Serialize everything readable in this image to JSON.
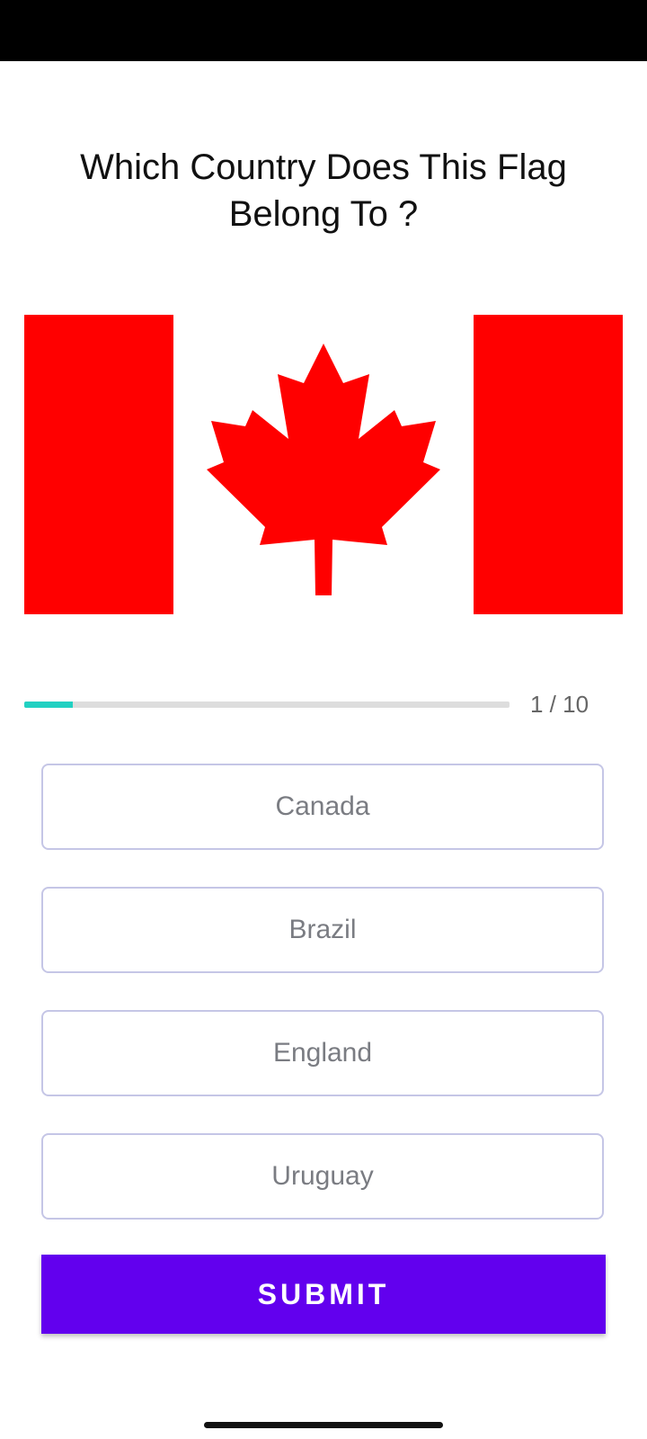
{
  "question": "Which Country Does This Flag Belong To ?",
  "flag": {
    "icon": "canada-flag-icon",
    "colors": {
      "red": "#ff0000",
      "white": "#ffffff"
    }
  },
  "progress": {
    "current": 1,
    "total": 10,
    "fraction": 0.1,
    "label": "1 / 10",
    "color": "#22d1c2"
  },
  "options": [
    {
      "label": "Canada"
    },
    {
      "label": "Brazil"
    },
    {
      "label": "England"
    },
    {
      "label": "Uruguay"
    }
  ],
  "submit": {
    "label": "SUBMIT",
    "color": "#6200ee"
  }
}
